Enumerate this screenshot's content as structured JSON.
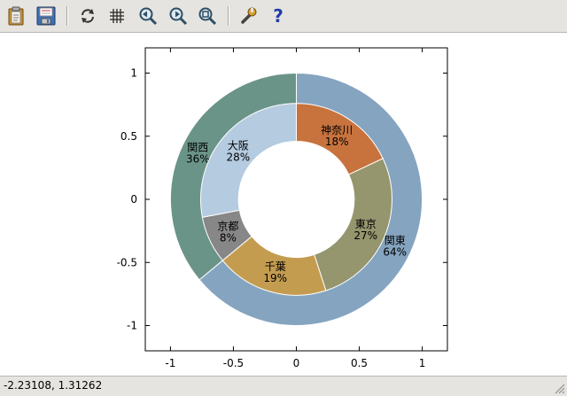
{
  "toolbar": {
    "buttons": [
      {
        "name": "copy-to-clipboard-button",
        "icon": "clipboard-icon"
      },
      {
        "name": "save-button",
        "icon": "save-icon"
      },
      {
        "name": "replot-button",
        "icon": "refresh-icon"
      },
      {
        "name": "grid-button",
        "icon": "grid-icon"
      },
      {
        "name": "unzoom-back-button",
        "icon": "zoom-back-icon"
      },
      {
        "name": "unzoom-forward-button",
        "icon": "zoom-forward-icon"
      },
      {
        "name": "unzoom-all-button",
        "icon": "zoom-reset-icon"
      },
      {
        "name": "options-button",
        "icon": "wrench-icon"
      },
      {
        "name": "help-button",
        "icon": "help-icon",
        "glyph": "?"
      }
    ]
  },
  "statusbar": {
    "coordinates": "-2.23108,  1.31262"
  },
  "chart_data": {
    "type": "pie",
    "subtype": "nested donut",
    "xlim": [
      -1.2,
      1.2
    ],
    "ylim": [
      -1.2,
      1.2
    ],
    "xticks": [
      -1,
      -0.5,
      0,
      0.5,
      1
    ],
    "yticks": [
      1,
      0.5,
      0,
      -0.5,
      -1
    ],
    "xtick_labels": [
      "-1",
      "-0.5",
      "0",
      "0.5",
      "1"
    ],
    "ytick_labels": [
      "1",
      "0.5",
      "0",
      "-0.5",
      "-1"
    ],
    "grid": false,
    "rings": [
      {
        "level": "outer",
        "slices": [
          {
            "label": "関東",
            "value": 64,
            "pct_label": "64%",
            "color": "#85a4c0"
          },
          {
            "label": "関西",
            "value": 36,
            "pct_label": "36%",
            "color": "#6b9488"
          }
        ]
      },
      {
        "level": "inner",
        "slices": [
          {
            "label": "神奈川",
            "value": 18,
            "pct_label": "18%",
            "color": "#c8733e"
          },
          {
            "label": "東京",
            "value": 27,
            "pct_label": "27%",
            "color": "#95956e"
          },
          {
            "label": "千葉",
            "value": 19,
            "pct_label": "19%",
            "color": "#c49c50"
          },
          {
            "label": "京都",
            "value": 8,
            "pct_label": "8%",
            "color": "#878787"
          },
          {
            "label": "大阪",
            "value": 28,
            "pct_label": "28%",
            "color": "#b4cbe0"
          }
        ]
      }
    ]
  }
}
